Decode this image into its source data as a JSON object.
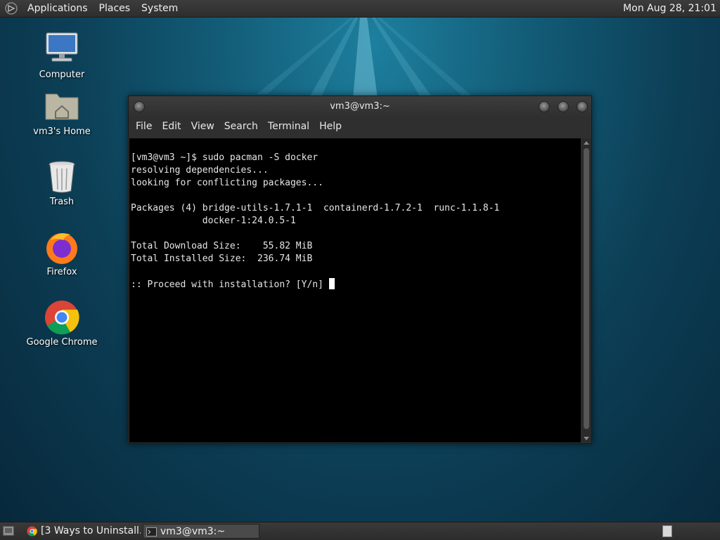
{
  "top_panel": {
    "menus": [
      "Applications",
      "Places",
      "System"
    ],
    "clock": "Mon Aug 28, 21:01"
  },
  "desktop": {
    "icons": [
      {
        "label": "Computer",
        "icon": "computer-icon"
      },
      {
        "label": "vm3's Home",
        "icon": "home-folder-icon"
      },
      {
        "label": "Trash",
        "icon": "trash-icon"
      },
      {
        "label": "Firefox",
        "icon": "firefox-icon"
      },
      {
        "label": "Google Chrome",
        "icon": "chrome-icon"
      }
    ]
  },
  "terminal": {
    "title": "vm3@vm3:~",
    "menus": [
      "File",
      "Edit",
      "View",
      "Search",
      "Terminal",
      "Help"
    ],
    "lines": [
      "[vm3@vm3 ~]$ sudo pacman -S docker",
      "resolving dependencies...",
      "looking for conflicting packages...",
      "",
      "Packages (4) bridge-utils-1.7.1-1  containerd-1.7.2-1  runc-1.1.8-1",
      "             docker-1:24.0.5-1",
      "",
      "Total Download Size:    55.82 MiB",
      "Total Installed Size:  236.74 MiB",
      "",
      ":: Proceed with installation? [Y/n] "
    ]
  },
  "taskbar": {
    "tasks": [
      {
        "label": "[3 Ways to Uninstall...",
        "icon": "chrome-icon"
      },
      {
        "label": "vm3@vm3:~",
        "icon": "terminal-icon"
      }
    ]
  },
  "colors": {
    "desktop_bg": "#0c3f56",
    "panel_bg": "#333333",
    "terminal_bg": "#000000",
    "terminal_fg": "#e6e6e6"
  }
}
